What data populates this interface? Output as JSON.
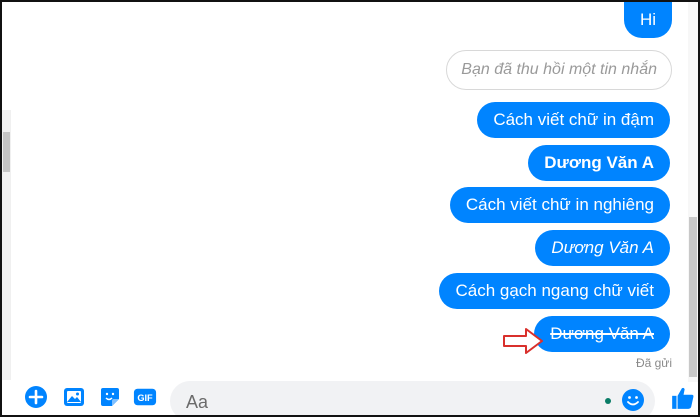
{
  "messages": [
    {
      "text": "Hi",
      "style": "normal"
    },
    {
      "text": "Cách viết chữ in đậm",
      "style": "normal"
    },
    {
      "text": "Dương Văn A",
      "style": "bold"
    },
    {
      "text": "Cách viết chữ in nghiêng",
      "style": "normal"
    },
    {
      "text": "Dương Văn A",
      "style": "italic"
    },
    {
      "text": "Cách gạch ngang chữ viết",
      "style": "normal"
    },
    {
      "text": "Dương Văn A",
      "style": "strike"
    }
  ],
  "recalled_message": "Bạn đã thu hồi một tin nhắn",
  "sent_status": "Đã gửi",
  "composer": {
    "placeholder": "Aa",
    "gif_label": "GIF",
    "icons": [
      "plus-icon",
      "photo-icon",
      "sticker-icon",
      "gif-icon",
      "emoji-icon",
      "like-icon"
    ]
  },
  "colors": {
    "bubble": "#0084ff",
    "accent": "#0084ff",
    "annotation_arrow": "#d9302c"
  }
}
